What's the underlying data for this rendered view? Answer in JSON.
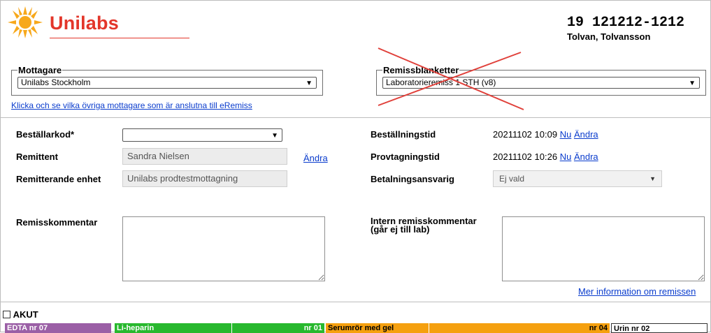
{
  "brand": {
    "name": "Unilabs",
    "color": "#e3362a"
  },
  "patient": {
    "id": "19 121212-1212",
    "name": "Tolvan, Tolvansson"
  },
  "mottagare": {
    "legend": "Mottagare",
    "selected": "Unilabs Stockholm",
    "link": "Klicka och se vilka övriga mottagare som är anslutna till eRemiss"
  },
  "remissblanketter": {
    "legend": "Remissblanketter",
    "selected": "Laboratorieremiss 1 STH (v8)"
  },
  "form": {
    "bestallarkod_label": "Beställarkod*",
    "bestallarkod_value": "",
    "remittent_label": "Remittent",
    "remittent_value": "Sandra Nielsen",
    "remittent_change": "Ändra",
    "enhet_label": "Remitterande enhet",
    "enhet_value": "Unilabs prodtestmottagning",
    "bestallningstid_label": "Beställningstid",
    "bestallningstid_value": "20211102 10:09",
    "provtagningstid_label": "Provtagningstid",
    "provtagningstid_value": "20211102 10:26",
    "now_link": "Nu",
    "change_link": "Ändra",
    "betalning_label": "Betalningsansvarig",
    "betalning_value": "Ej vald",
    "remisskommentar_label": "Remisskommentar",
    "intern_label_1": "Intern remisskommentar",
    "intern_label_2": "(går ej till lab)",
    "more_info_link": "Mer information om remissen",
    "akut_label": "AKUT"
  },
  "tubes": [
    {
      "label": "EDTA nr 07",
      "color": "#9b5fa6"
    },
    {
      "label": "Li-heparin",
      "color": "#28b82e"
    },
    {
      "label": "nr 01",
      "color": "#28b82e"
    },
    {
      "label": "Serumrör med gel",
      "color": "#f5a00f"
    },
    {
      "label": "nr 04",
      "color": "#f5a00f"
    },
    {
      "label": "Urin nr 02",
      "color": "#ffffff"
    }
  ],
  "icons": {
    "logo": "sun-icon",
    "dropdown": "chevron-down-icon",
    "strike": "red-cross-icon"
  }
}
